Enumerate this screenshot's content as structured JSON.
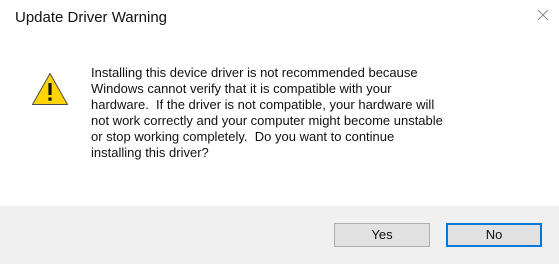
{
  "window": {
    "title": "Update Driver Warning"
  },
  "message": {
    "icon": "warning-triangle-icon",
    "text": "Installing this device driver is not recommended because\nWindows cannot verify that it is compatible with your\nhardware.  If the driver is not compatible, your hardware will\nnot work correctly and your computer might become unstable\nor stop working completely.  Do you want to continue\ninstalling this driver?"
  },
  "buttons": {
    "yes_label": "Yes",
    "no_label": "No"
  },
  "colors": {
    "warning_fill": "#ffd400",
    "focus_border": "#0078d7",
    "footer_bg": "#f0f0f0"
  }
}
